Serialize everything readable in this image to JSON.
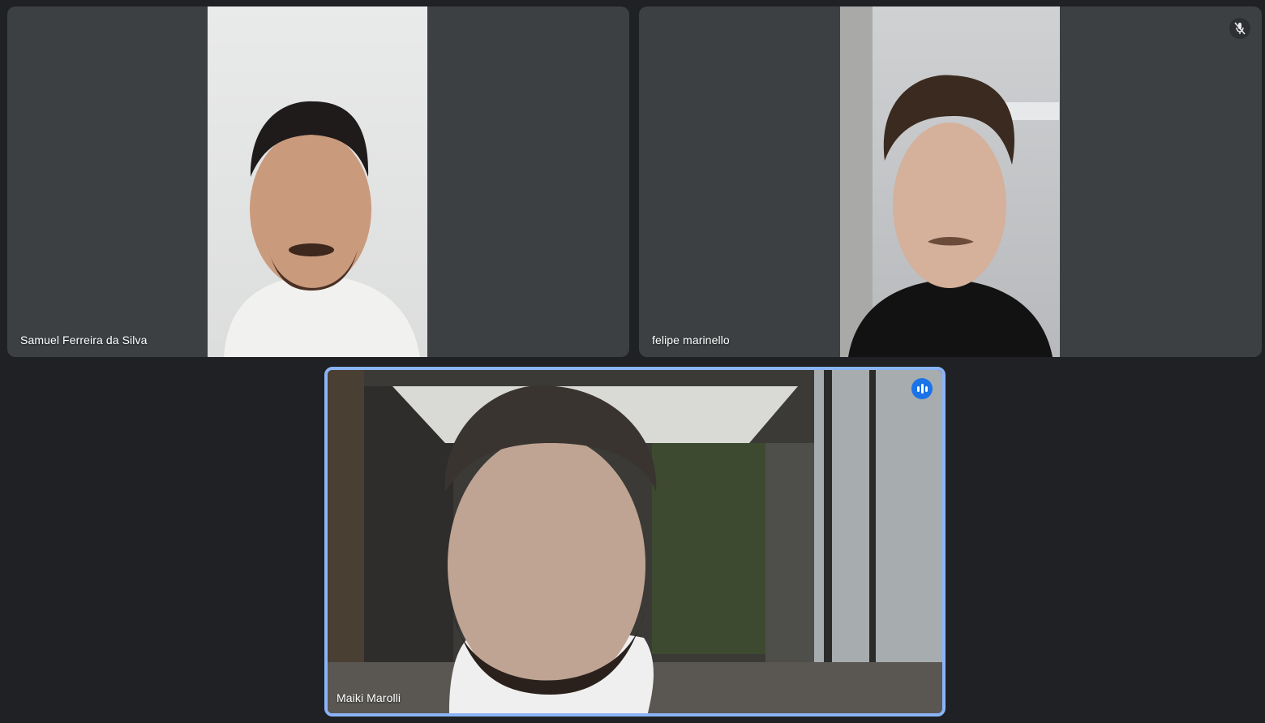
{
  "participants": [
    {
      "name": "Samuel Ferreira da Silva",
      "muted": false,
      "speaking": false
    },
    {
      "name": "felipe marinello",
      "muted": true,
      "speaking": false
    },
    {
      "name": "Maiki Marolli",
      "muted": false,
      "speaking": true
    }
  ],
  "icons": {
    "muted": "mic-off-icon",
    "speaking": "speaking-indicator-icon"
  },
  "colors": {
    "background": "#202124",
    "tile": "#3c4043",
    "active_speaker_border": "#8ab4f8",
    "speaking_badge": "#1a73e8"
  }
}
